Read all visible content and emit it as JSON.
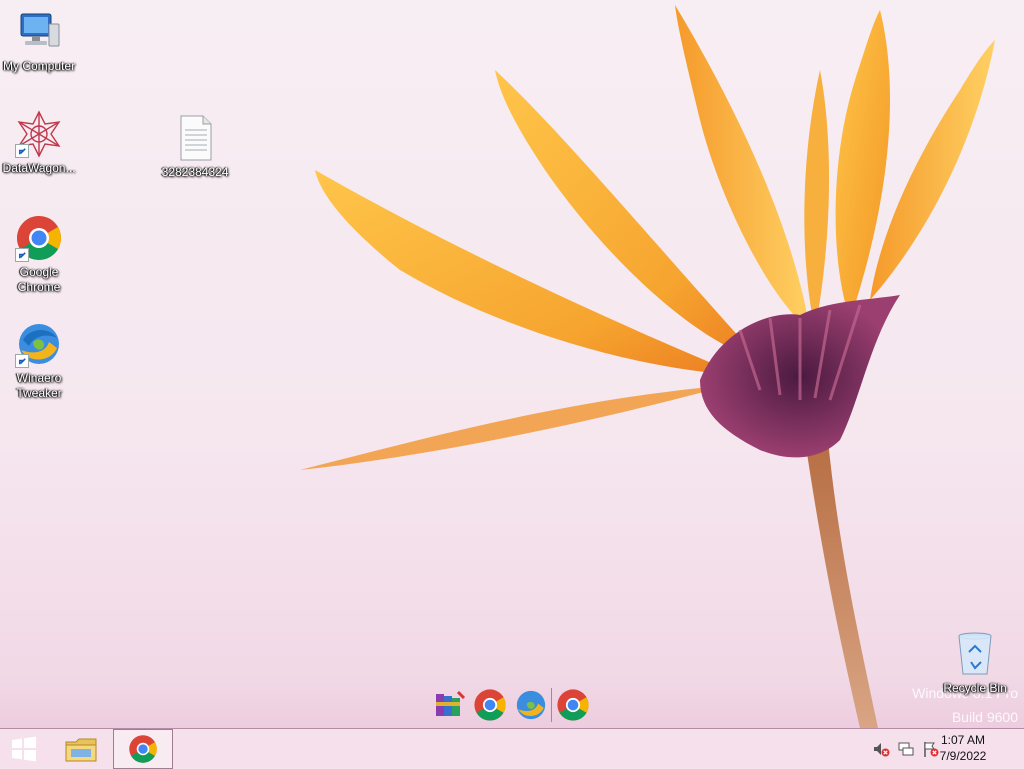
{
  "desktop": {
    "icons": [
      {
        "name": "my-computer",
        "label": "My Computer"
      },
      {
        "name": "datawagon",
        "label": "DataWagon..."
      },
      {
        "name": "text-file",
        "label": "3282384324"
      },
      {
        "name": "google-chrome",
        "label": "Google Chrome"
      },
      {
        "name": "winaero-tweaker",
        "label": "Winaero Tweaker"
      },
      {
        "name": "recycle-bin",
        "label": "Recycle Bin"
      }
    ],
    "watermark": {
      "line1": "Windows 8.1 Pro",
      "line2": "Build 9600"
    }
  },
  "dock": {
    "items": [
      "winrar-icon",
      "chrome-icon",
      "winaero-icon",
      "chrome-icon"
    ]
  },
  "taskbar": {
    "start_icon": "windows-logo-icon",
    "pinned": [
      "file-explorer-icon",
      "chrome-icon"
    ],
    "tray": [
      "speaker-muted-icon",
      "network-icon",
      "action-center-icon"
    ],
    "clock": {
      "time": "1:07 AM",
      "date": "7/9/2022"
    }
  }
}
